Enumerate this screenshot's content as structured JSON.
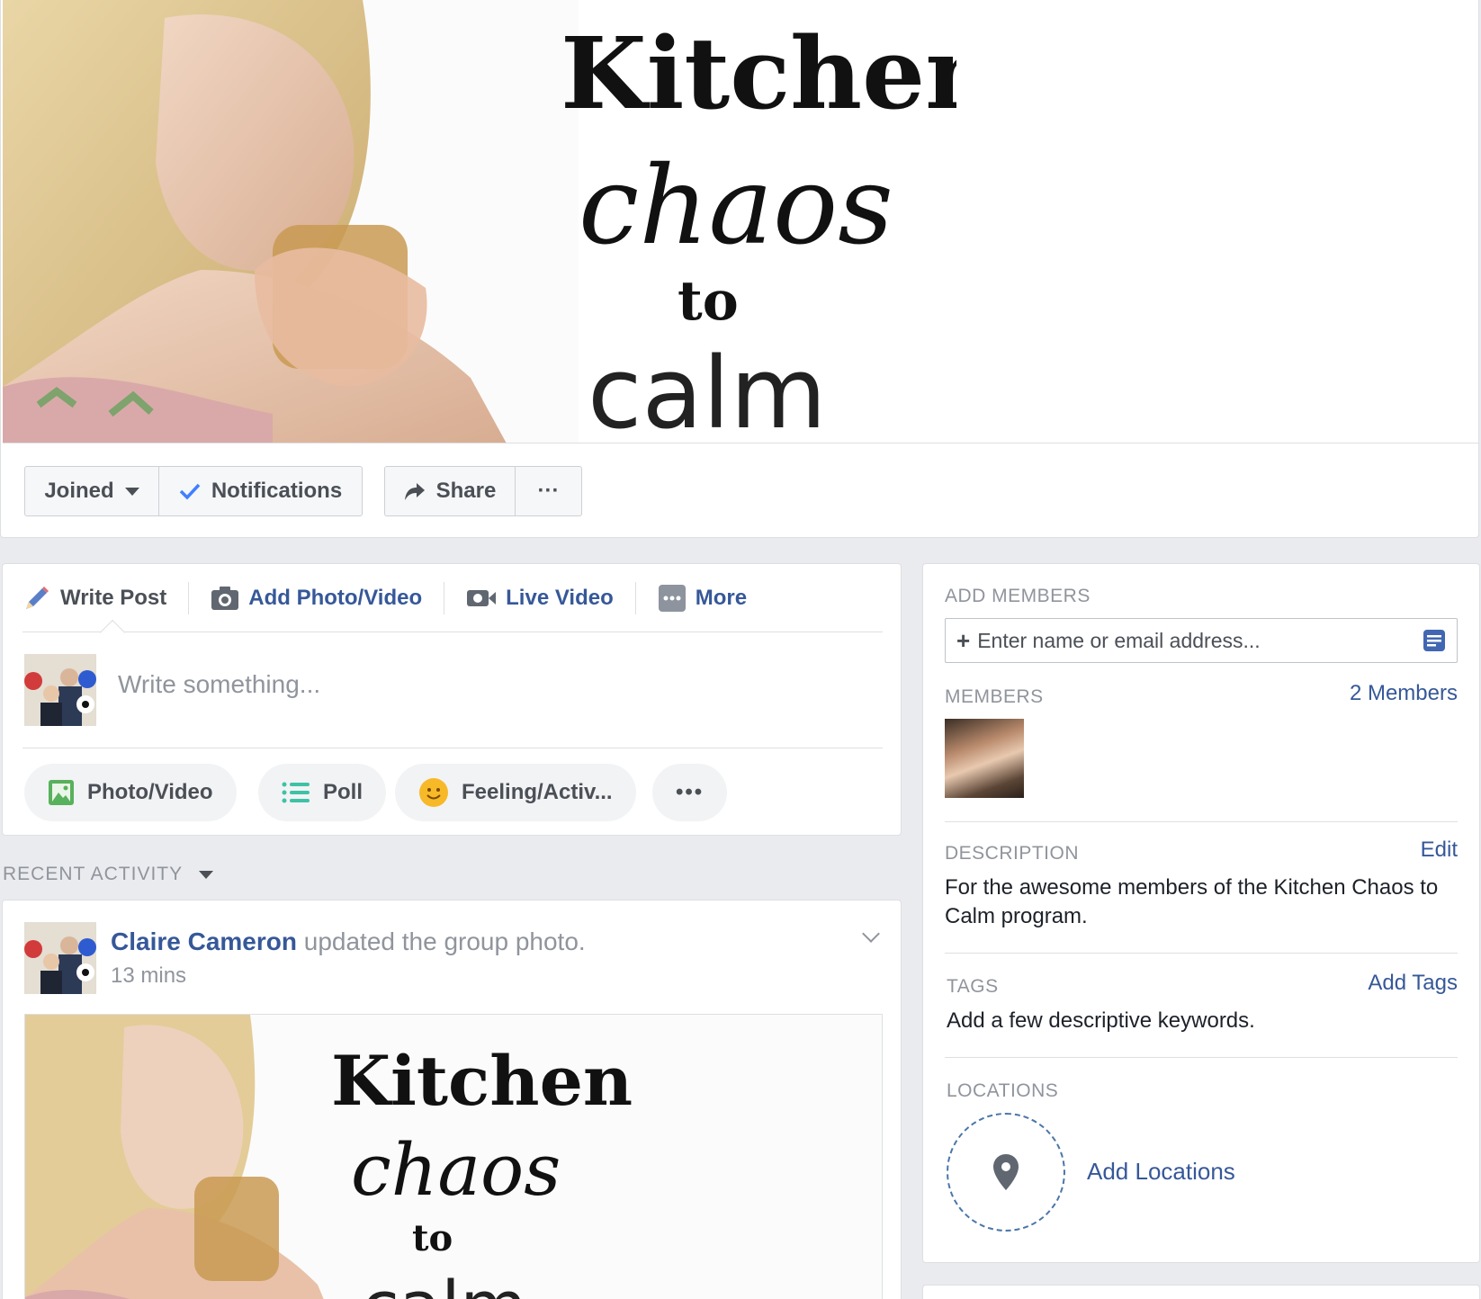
{
  "cover": {
    "title_line1": "Kitchen",
    "title_line2": "chaos",
    "title_line3": "to",
    "title_line4": "calm"
  },
  "actions": {
    "joined": "Joined",
    "notifications": "Notifications",
    "share": "Share",
    "more": "···"
  },
  "composer": {
    "tabs": [
      {
        "label": "Write Post",
        "icon": "pencil-icon"
      },
      {
        "label": "Add Photo/Video",
        "icon": "camera-icon"
      },
      {
        "label": "Live Video",
        "icon": "video-camera-icon"
      },
      {
        "label": "More",
        "icon": "more-icon"
      }
    ],
    "placeholder": "Write something...",
    "pills": [
      {
        "label": "Photo/Video",
        "icon": "photo-icon"
      },
      {
        "label": "Poll",
        "icon": "list-icon"
      },
      {
        "label": "Feeling/Activ...",
        "icon": "smiley-icon"
      },
      {
        "label": "•••",
        "icon": "more-dots-icon"
      }
    ]
  },
  "recent_activity": {
    "label": "RECENT ACTIVITY"
  },
  "post": {
    "author": "Claire Cameron",
    "action": " updated the group photo.",
    "time": "13 mins"
  },
  "sidebar": {
    "add_members": {
      "heading": "ADD MEMBERS",
      "placeholder": "Enter name or email address..."
    },
    "members": {
      "heading": "MEMBERS",
      "count_link": "2 Members"
    },
    "description": {
      "heading": "DESCRIPTION",
      "edit": "Edit",
      "text": "For the awesome members of the Kitchen Chaos to Calm program."
    },
    "tags": {
      "heading": "TAGS",
      "add": "Add Tags",
      "text": "Add a few descriptive keywords."
    },
    "locations": {
      "heading": "LOCATIONS",
      "add": "Add Locations"
    }
  },
  "colors": {
    "link": "#365899",
    "muted": "#90949c",
    "background": "#e9ebee",
    "check": "#4080ff"
  }
}
